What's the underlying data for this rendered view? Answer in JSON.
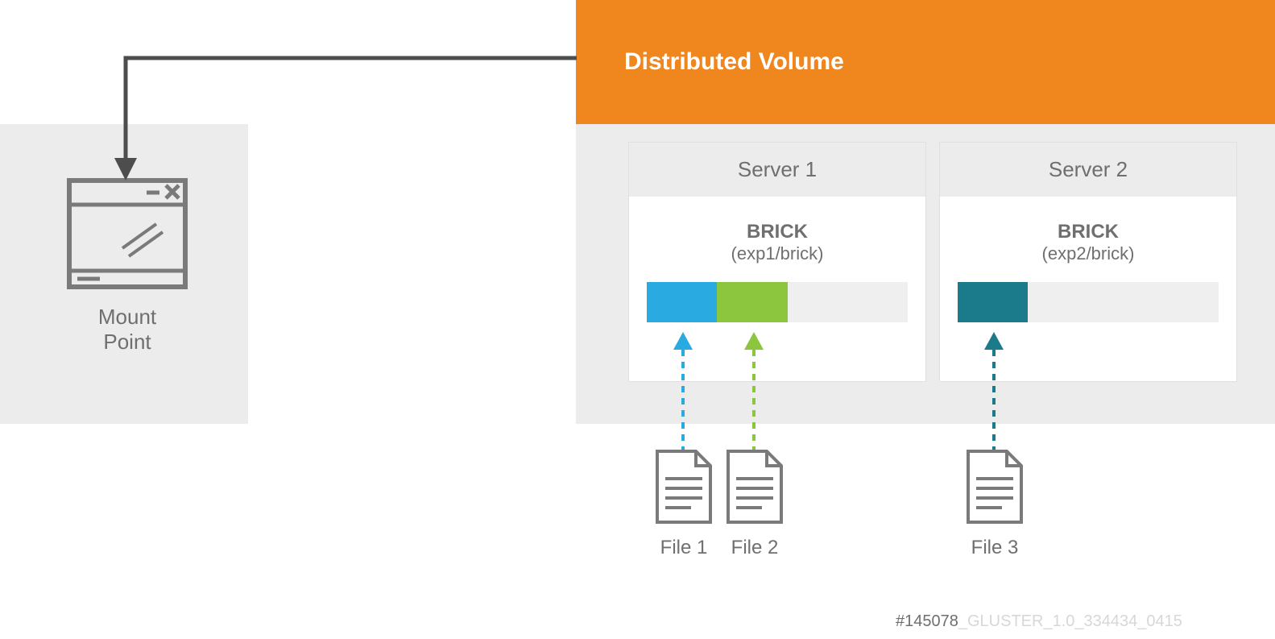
{
  "title": "Distributed Volume",
  "mount_point": {
    "line1": "Mount",
    "line2": "Point"
  },
  "servers": [
    {
      "name": "Server 1",
      "brick_title": "BRICK",
      "brick_path": "(exp1/brick)",
      "segments": [
        {
          "color": "#29abe2",
          "width_pct": 27
        },
        {
          "color": "#8cc63f",
          "width_pct": 27
        }
      ]
    },
    {
      "name": "Server 2",
      "brick_title": "BRICK",
      "brick_path": "(exp2/brick)",
      "segments": [
        {
          "color": "#1b7b8a",
          "width_pct": 27
        }
      ]
    }
  ],
  "files": [
    {
      "label": "File 1",
      "arrow_color": "#29abe2"
    },
    {
      "label": "File 2",
      "arrow_color": "#8cc63f"
    },
    {
      "label": "File 3",
      "arrow_color": "#1b7b8a"
    }
  ],
  "footer": {
    "visible": "#145078",
    "faded": "_GLUSTER_1.0_334434_0415"
  },
  "colors": {
    "orange": "#f0861e",
    "gray_bg": "#ececec",
    "gray_text": "#6f6f6f",
    "cyan": "#29abe2",
    "green": "#8cc63f",
    "teal": "#1b7b8a"
  }
}
